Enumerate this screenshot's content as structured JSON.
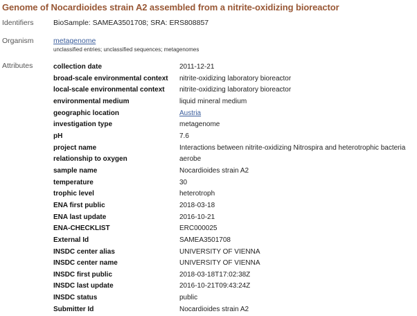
{
  "title": "Genome of Nocardioides strain A2 assembled from a nitrite-oxidizing bioreactor",
  "identifiers": {
    "label": "Identifiers",
    "value": "BioSample: SAMEA3501708; SRA: ERS808857"
  },
  "organism": {
    "label": "Organism",
    "name": "metagenome",
    "lineage": "unclassified entries; unclassified sequences; metagenomes"
  },
  "attributes": {
    "label": "Attributes",
    "rows": [
      {
        "name": "collection date",
        "value": "2011-12-21"
      },
      {
        "name": "broad-scale environmental context",
        "value": "nitrite-oxidizing laboratory bioreactor"
      },
      {
        "name": "local-scale environmental context",
        "value": "nitrite-oxidizing laboratory bioreactor"
      },
      {
        "name": "environmental medium",
        "value": "liquid mineral medium"
      },
      {
        "name": "geographic location",
        "value": "Austria",
        "link": true
      },
      {
        "name": "investigation type",
        "value": "metagenome"
      },
      {
        "name": "pH",
        "value": "7.6"
      },
      {
        "name": "project name",
        "value": "Interactions between nitrite-oxidizing Nitrospira and heterotrophic bacteria"
      },
      {
        "name": "relationship to oxygen",
        "value": "aerobe"
      },
      {
        "name": "sample name",
        "value": "Nocardioides strain A2"
      },
      {
        "name": "temperature",
        "value": "30"
      },
      {
        "name": "trophic level",
        "value": "heterotroph"
      },
      {
        "name": "ENA first public",
        "value": "2018-03-18"
      },
      {
        "name": "ENA last update",
        "value": "2016-10-21"
      },
      {
        "name": "ENA-CHECKLIST",
        "value": "ERC000025"
      },
      {
        "name": "External Id",
        "value": "SAMEA3501708"
      },
      {
        "name": "INSDC center alias",
        "value": "UNIVERSITY OF VIENNA"
      },
      {
        "name": "INSDC center name",
        "value": "UNIVERSITY OF VIENNA"
      },
      {
        "name": "INSDC first public",
        "value": "2018-03-18T17:02:38Z"
      },
      {
        "name": "INSDC last update",
        "value": "2016-10-21T09:43:24Z"
      },
      {
        "name": "INSDC status",
        "value": "public"
      },
      {
        "name": "Submitter Id",
        "value": "Nocardioides strain A2"
      }
    ]
  },
  "colors": {
    "title": "#985735",
    "link": "#3a5d9c",
    "section_label": "#555555"
  }
}
